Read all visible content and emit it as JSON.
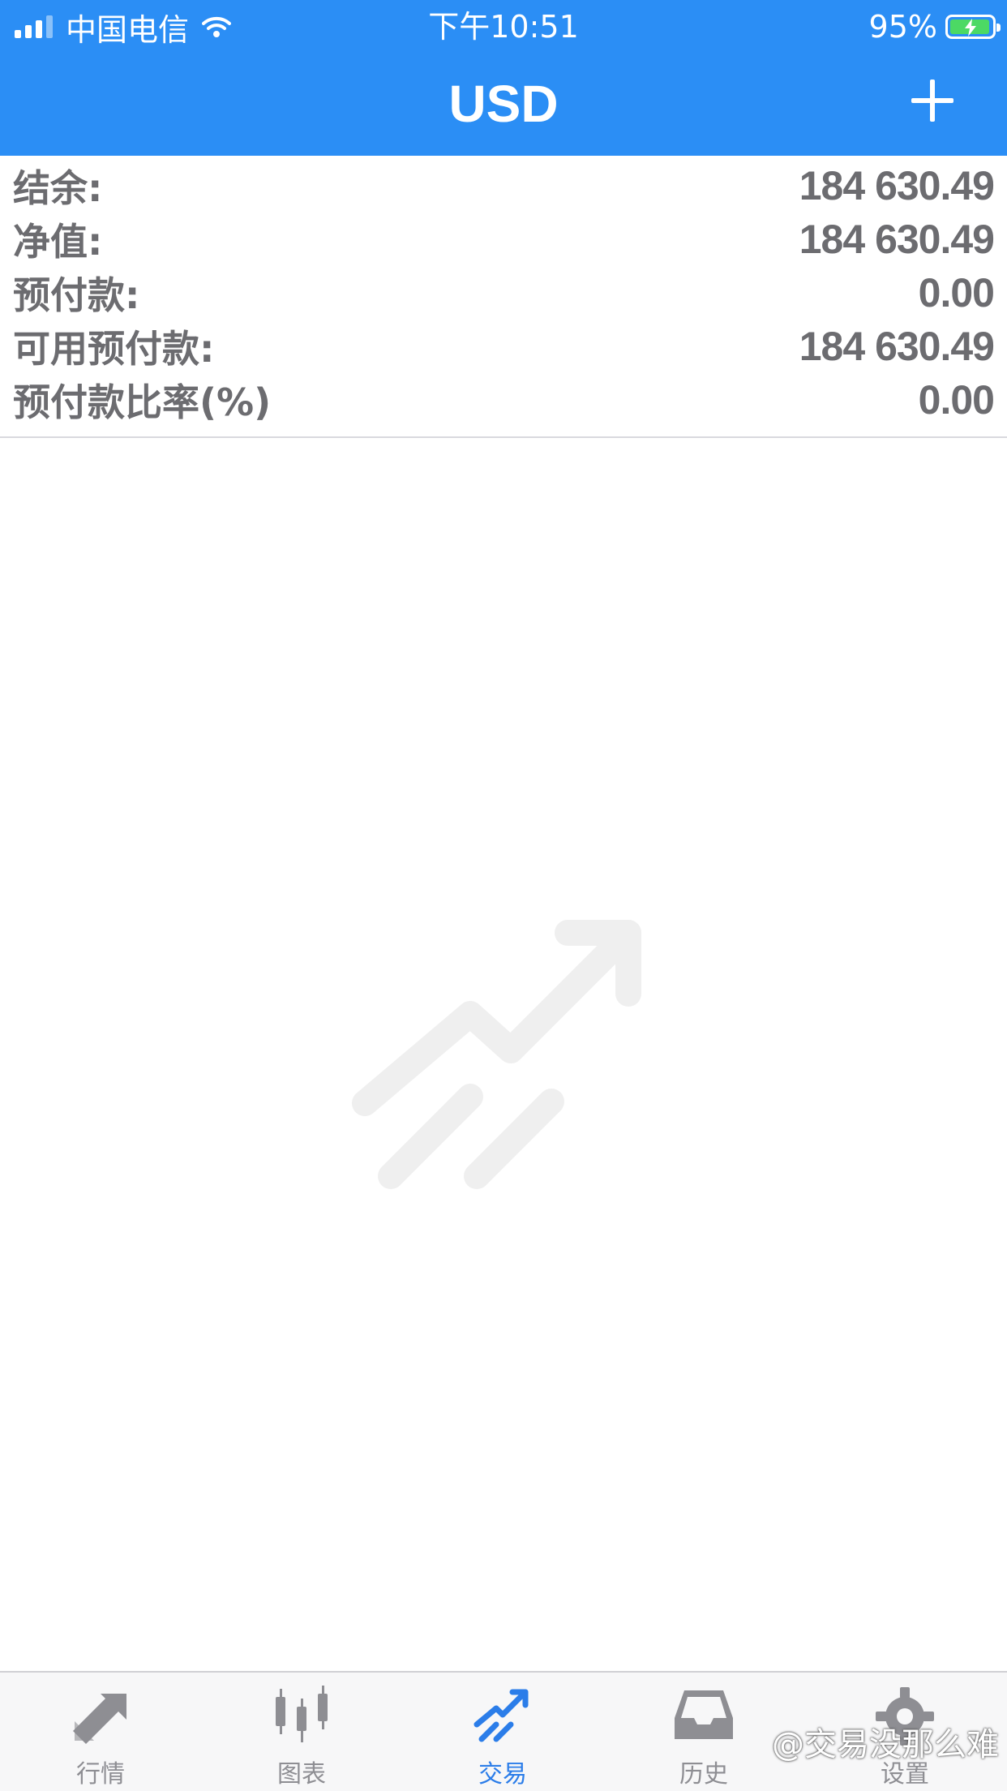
{
  "status_bar": {
    "carrier": "中国电信",
    "time": "下午10:51",
    "battery": "95%"
  },
  "header": {
    "title": "USD",
    "add_icon": "plus-icon"
  },
  "account": {
    "rows": [
      {
        "label": "结余:",
        "value": "184 630.49"
      },
      {
        "label": "净值:",
        "value": "184 630.49"
      },
      {
        "label": "预付款:",
        "value": "0.00"
      },
      {
        "label": "可用预付款:",
        "value": "184 630.49"
      },
      {
        "label": "预付款比率(%)",
        "value": "0.00"
      }
    ]
  },
  "tabs": [
    {
      "label": "行情",
      "icon": "quotes-arrows-icon",
      "active": false
    },
    {
      "label": "图表",
      "icon": "candlestick-chart-icon",
      "active": false
    },
    {
      "label": "交易",
      "icon": "trade-trend-icon",
      "active": true
    },
    {
      "label": "历史",
      "icon": "history-inbox-icon",
      "active": false
    },
    {
      "label": "设置",
      "icon": "gear-icon",
      "active": false
    }
  ],
  "watermark": "@交易没那么难",
  "colors": {
    "accent": "#2b8ef5",
    "active_tab": "#2b7de9",
    "inactive_tab": "#8e8e93",
    "text": "#6c6c70"
  }
}
